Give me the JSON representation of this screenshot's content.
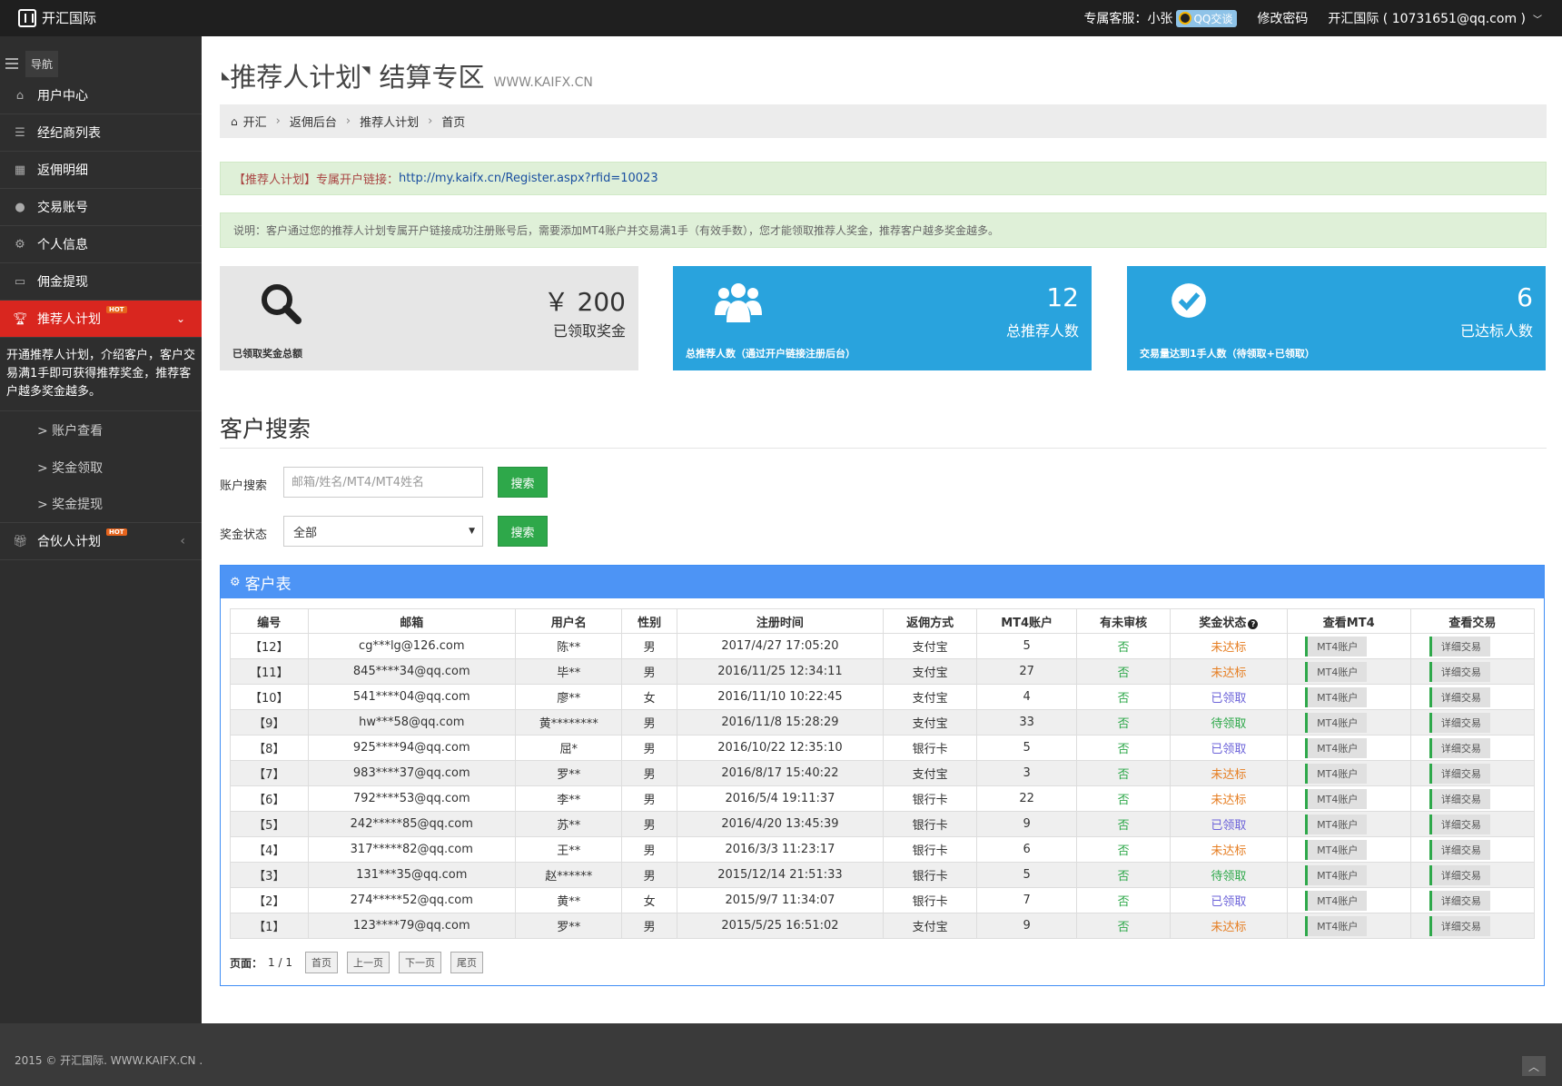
{
  "topbar": {
    "brand": "开汇国际",
    "service_label": "专属客服：",
    "service_name": "小张",
    "qq_label": "QQ交谈",
    "change_password": "修改密码",
    "account": "开汇国际 ( 10731651@qq.com )"
  },
  "sidebar": {
    "nav_label": "导航",
    "items": [
      {
        "label": "用户中心",
        "icon": "home-icon"
      },
      {
        "label": "经纪商列表",
        "icon": "list-icon"
      },
      {
        "label": "返佣明细",
        "icon": "table-icon"
      },
      {
        "label": "交易账号",
        "icon": "user-icon"
      },
      {
        "label": "个人信息",
        "icon": "cogs-icon"
      },
      {
        "label": "佣金提现",
        "icon": "card-icon"
      }
    ],
    "active_item": {
      "label": "推荐人计划",
      "hot": "HOT",
      "icon": "trophy-icon"
    },
    "active_desc": "开通推荐人计划，介绍客户，客户交易满1手即可获得推荐奖金，推荐客户越多奖金越多。",
    "sub_items": [
      "> 账户查看",
      "> 奖金领取",
      "> 奖金提现"
    ],
    "partner_item": {
      "label": "合伙人计划",
      "hot": "HOT",
      "icon": "gift-icon"
    }
  },
  "page": {
    "title": "推荐人计划",
    "title2": "结算专区",
    "subtitle": "WWW.KAIFX.CN"
  },
  "breadcrumb": [
    "开汇",
    "返佣后台",
    "推荐人计划",
    "首页"
  ],
  "alerts": {
    "link_tag": "【推荐人计划】专属开户链接：",
    "link_url": "http://my.kaifx.cn/Register.aspx?rfid=10023",
    "note": "说明：客户通过您的推荐人计划专属开户链接成功注册账号后，需要添加MT4账户并交易满1手（有效手数），您才能领取推荐人奖金，推荐客户越多奖金越多。"
  },
  "stats": [
    {
      "value": "￥ 200",
      "caption": "已领取奖金",
      "footer": "已领取奖金总额",
      "icon": "search-icon"
    },
    {
      "value": "12",
      "caption": "总推荐人数",
      "footer": "总推荐人数（通过开户链接注册后台）",
      "icon": "users-icon"
    },
    {
      "value": "6",
      "caption": "已达标人数",
      "footer": "交易量达到1手人数（待领取+已领取）",
      "icon": "check-circle-icon"
    }
  ],
  "search": {
    "section_title": "客户搜索",
    "account_label": "账户搜索",
    "account_placeholder": "邮箱/姓名/MT4/MT4姓名",
    "status_label": "奖金状态",
    "status_value": "全部",
    "search_button": "搜索"
  },
  "table": {
    "title": "客户表",
    "headers": [
      "编号",
      "邮箱",
      "用户名",
      "性别",
      "注册时间",
      "返佣方式",
      "MT4账户",
      "有未审核",
      "奖金状态",
      "查看MT4",
      "查看交易"
    ],
    "mt4_btn": "MT4账户",
    "trade_btn": "详细交易",
    "rows": [
      [
        "【12】",
        "cg***lg@126.com",
        "陈**",
        "男",
        "2017/4/27 17:05:20",
        "支付宝",
        "5",
        "否",
        "未达标"
      ],
      [
        "【11】",
        "845****34@qq.com",
        "毕**",
        "男",
        "2016/11/25 12:34:11",
        "支付宝",
        "27",
        "否",
        "未达标"
      ],
      [
        "【10】",
        "541****04@qq.com",
        "廖**",
        "女",
        "2016/11/10 10:22:45",
        "支付宝",
        "4",
        "否",
        "已领取"
      ],
      [
        "【9】",
        "hw***58@qq.com",
        "黄********",
        "男",
        "2016/11/8 15:28:29",
        "支付宝",
        "33",
        "否",
        "待领取"
      ],
      [
        "【8】",
        "925****94@qq.com",
        "屈*",
        "男",
        "2016/10/22 12:35:10",
        "银行卡",
        "5",
        "否",
        "已领取"
      ],
      [
        "【7】",
        "983****37@qq.com",
        "罗**",
        "男",
        "2016/8/17 15:40:22",
        "支付宝",
        "3",
        "否",
        "未达标"
      ],
      [
        "【6】",
        "792****53@qq.com",
        "李**",
        "男",
        "2016/5/4 19:11:37",
        "银行卡",
        "22",
        "否",
        "未达标"
      ],
      [
        "【5】",
        "242*****85@qq.com",
        "苏**",
        "男",
        "2016/4/20 13:45:39",
        "银行卡",
        "9",
        "否",
        "已领取"
      ],
      [
        "【4】",
        "317*****82@qq.com",
        "王**",
        "男",
        "2016/3/3 11:23:17",
        "银行卡",
        "6",
        "否",
        "未达标"
      ],
      [
        "【3】",
        "131***35@qq.com",
        "赵******",
        "男",
        "2015/12/14 21:51:33",
        "银行卡",
        "5",
        "否",
        "待领取"
      ],
      [
        "【2】",
        "274*****52@qq.com",
        "黄**",
        "女",
        "2015/9/7 11:34:07",
        "银行卡",
        "7",
        "否",
        "已领取"
      ],
      [
        "【1】",
        "123****79@qq.com",
        "罗**",
        "男",
        "2015/5/25 16:51:02",
        "支付宝",
        "9",
        "否",
        "未达标"
      ]
    ]
  },
  "pager": {
    "label": "页面：",
    "value": "1 / 1",
    "buttons": [
      "首页",
      "上一页",
      "下一页",
      "尾页"
    ]
  },
  "footer": {
    "text": "2015 © 开汇国际. WWW.KAIFX.CN ."
  },
  "colors": {
    "accent": "#d9261f",
    "panel": "#4d94f5",
    "stat_blue": "#29a3dd",
    "green": "#2ea84a"
  }
}
